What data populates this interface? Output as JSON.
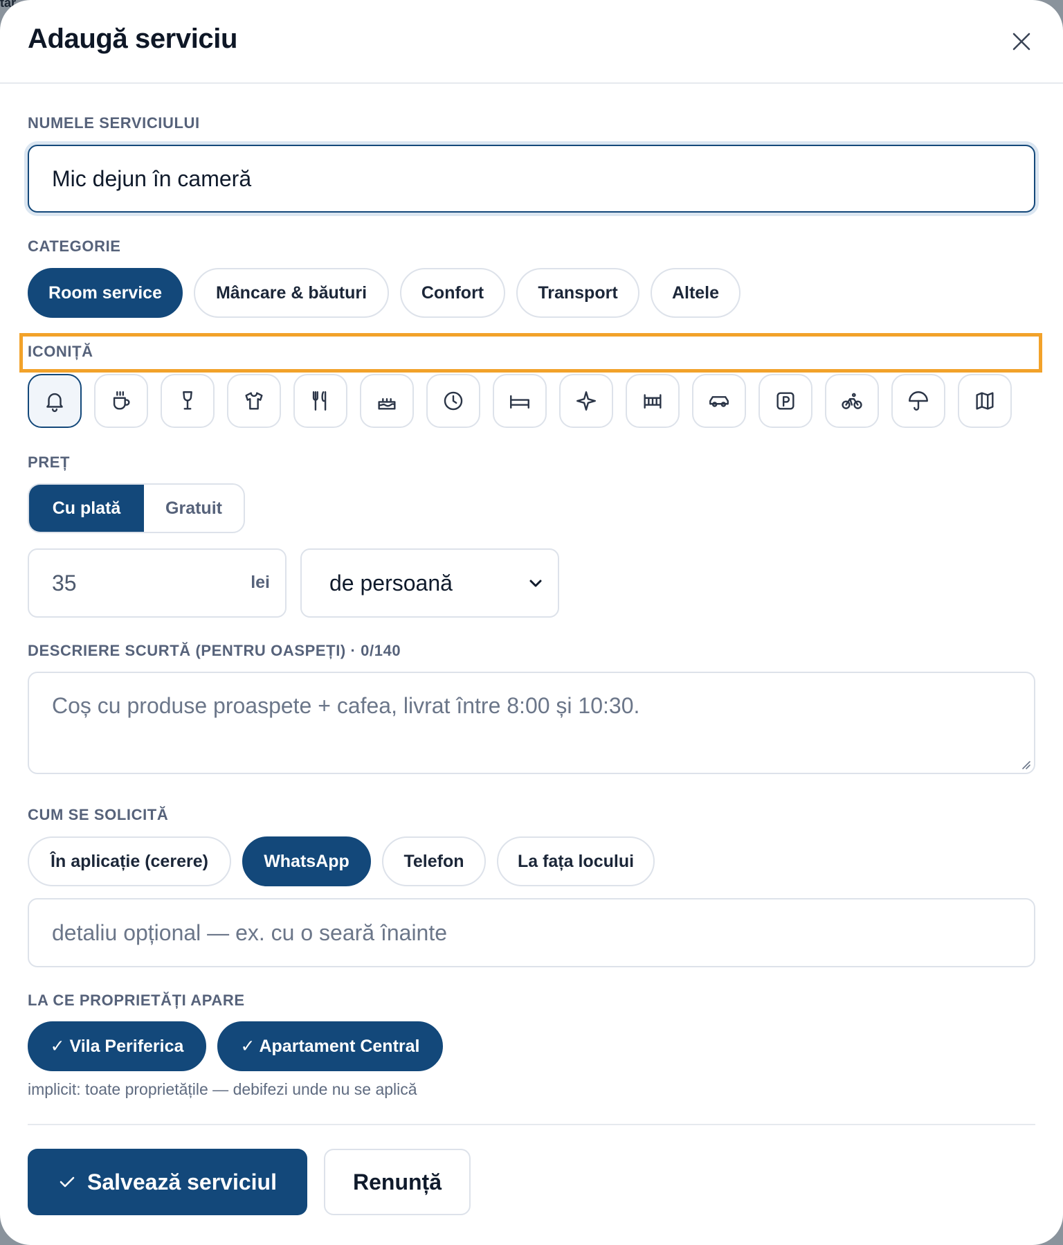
{
  "backdrop": {
    "text": "tar"
  },
  "modal": {
    "title": "Adaugă serviciu"
  },
  "name_field": {
    "label": "NUMELE SERVICIULUI",
    "value": "Mic dejun în cameră"
  },
  "category": {
    "label": "CATEGORIE",
    "options": [
      "Room service",
      "Mâncare & băuturi",
      "Confort",
      "Transport",
      "Altele"
    ],
    "selected": "Room service"
  },
  "icon_picker": {
    "label": "ICONIȚĂ",
    "icons": [
      "bell-icon",
      "coffee-icon",
      "wine-glass-icon",
      "shirt-icon",
      "utensils-icon",
      "cake-icon",
      "clock-icon",
      "bed-icon",
      "sparkle-icon",
      "crib-icon",
      "car-icon",
      "parking-icon",
      "bicycle-icon",
      "umbrella-icon",
      "map-icon"
    ],
    "selected": "bell-icon"
  },
  "price": {
    "label": "PREȚ",
    "modes": [
      "Cu plată",
      "Gratuit"
    ],
    "selected_mode": "Cu plată",
    "amount": "35",
    "currency": "lei",
    "unit": "de persoană"
  },
  "description": {
    "label": "DESCRIERE SCURTĂ (PENTRU OASPEȚI) · 0/140",
    "placeholder": "Coș cu produse proaspete + cafea, livrat între 8:00 și 10:30."
  },
  "request_method": {
    "label": "CUM SE SOLICITĂ",
    "options": [
      "În aplicație (cerere)",
      "WhatsApp",
      "Telefon",
      "La fața locului"
    ],
    "selected": "WhatsApp",
    "detail_placeholder": "detaliu opțional — ex. cu o seară înainte"
  },
  "properties": {
    "label": "LA CE PROPRIETĂȚI APARE",
    "items": [
      "✓ Vila Periferica",
      "✓ Apartament Central"
    ],
    "hint": "implicit: toate proprietățile — debifezi unde nu se aplică"
  },
  "actions": {
    "save": "Salvează serviciul",
    "cancel": "Renunță"
  },
  "colors": {
    "primary": "#13487a",
    "highlight": "#f2a22a",
    "label": "#56627a",
    "border": "#dde2ea"
  }
}
